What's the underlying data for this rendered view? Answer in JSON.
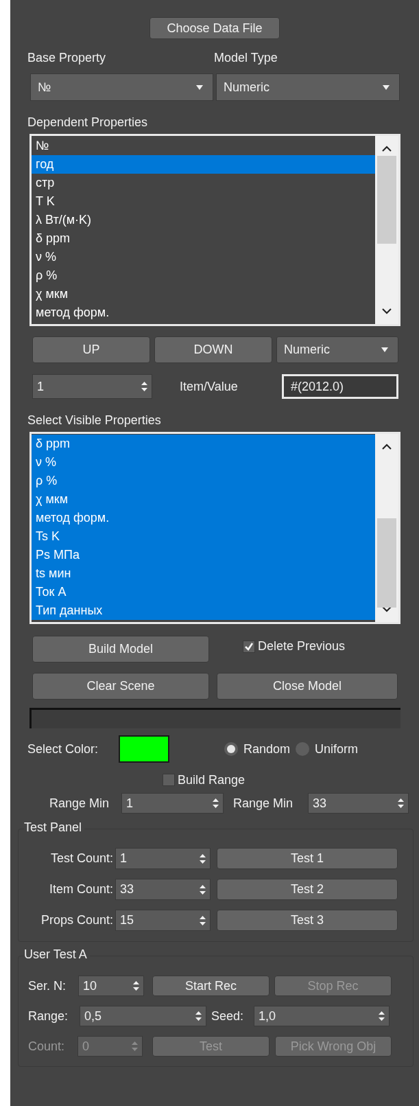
{
  "choose_button": "Choose Data File",
  "base_property": {
    "label": "Base Property",
    "value": "№"
  },
  "model_type": {
    "label": "Model Type",
    "value": "Numeric"
  },
  "dependent_properties": {
    "label": "Dependent Properties",
    "items": [
      {
        "text": "№",
        "selected": false
      },
      {
        "text": "год",
        "selected": true
      },
      {
        "text": "стр",
        "selected": false
      },
      {
        "text": "T K",
        "selected": false
      },
      {
        "text": "λ Вт/(м·K)",
        "selected": false
      },
      {
        "text": "δ ppm",
        "selected": false
      },
      {
        "text": "ν %",
        "selected": false
      },
      {
        "text": "ρ %",
        "selected": false
      },
      {
        "text": "χ мкм",
        "selected": false
      },
      {
        "text": "метод форм.",
        "selected": false
      }
    ]
  },
  "order_buttons": [
    "UP",
    "DOWN"
  ],
  "order_type": "Numeric",
  "item_index": "1",
  "item_value_label": "Item/Value",
  "item_value": "#(2012.0)",
  "visible_properties": {
    "label": "Select Visible Properties",
    "items": [
      {
        "text": "δ ppm",
        "selected": true
      },
      {
        "text": "ν %",
        "selected": true
      },
      {
        "text": "ρ %",
        "selected": true
      },
      {
        "text": "χ мкм",
        "selected": true
      },
      {
        "text": "метод форм.",
        "selected": true
      },
      {
        "text": "Ts K",
        "selected": true
      },
      {
        "text": "Ps МПа",
        "selected": true
      },
      {
        "text": "ts мин",
        "selected": true
      },
      {
        "text": "Ток А",
        "selected": true
      },
      {
        "text": "Тип данных",
        "selected": true
      }
    ]
  },
  "build_button": "Build Model",
  "delete_previous": {
    "label": "Delete Previous",
    "checked": true
  },
  "clear_button": "Clear Scene",
  "close_button": "Close Model",
  "progress": {
    "level": 0
  },
  "select_color": {
    "label": "Select Color:",
    "color": "#00ff00"
  },
  "color_mode": [
    {
      "label": "Random",
      "selected": true
    },
    {
      "label": "Uniform",
      "selected": false
    }
  ],
  "build_range": {
    "label": "Build Range",
    "checked": false
  },
  "range": [
    {
      "label": "Range Min",
      "value": "1"
    },
    {
      "label": "Range Min",
      "value": "33"
    }
  ],
  "test_panel": {
    "title": "Test Panel",
    "rows": [
      {
        "label": "Test Count:",
        "value": "1",
        "button": "Test 1"
      },
      {
        "label": "Item Count:",
        "value": "33",
        "button": "Test 2"
      },
      {
        "label": "Props Count:",
        "value": "15",
        "button": "Test 3"
      }
    ]
  },
  "user_test": {
    "title": "User Test A",
    "ser_n": {
      "label": "Ser. N:",
      "value": "10",
      "disabled": false
    },
    "start": {
      "label": "Start Rec",
      "disabled": false
    },
    "stop": {
      "label": "Stop Rec",
      "disabled": true
    },
    "range": {
      "label": "Range:",
      "value": "0,5",
      "disabled": false
    },
    "seed": {
      "label": "Seed:",
      "value": "1,0",
      "disabled": false
    },
    "count": {
      "label": "Count:",
      "value": "0",
      "disabled": true
    },
    "test": {
      "label": "Test",
      "disabled": true
    },
    "pick": {
      "label": "Pick Wrong Obj",
      "disabled": true
    }
  }
}
